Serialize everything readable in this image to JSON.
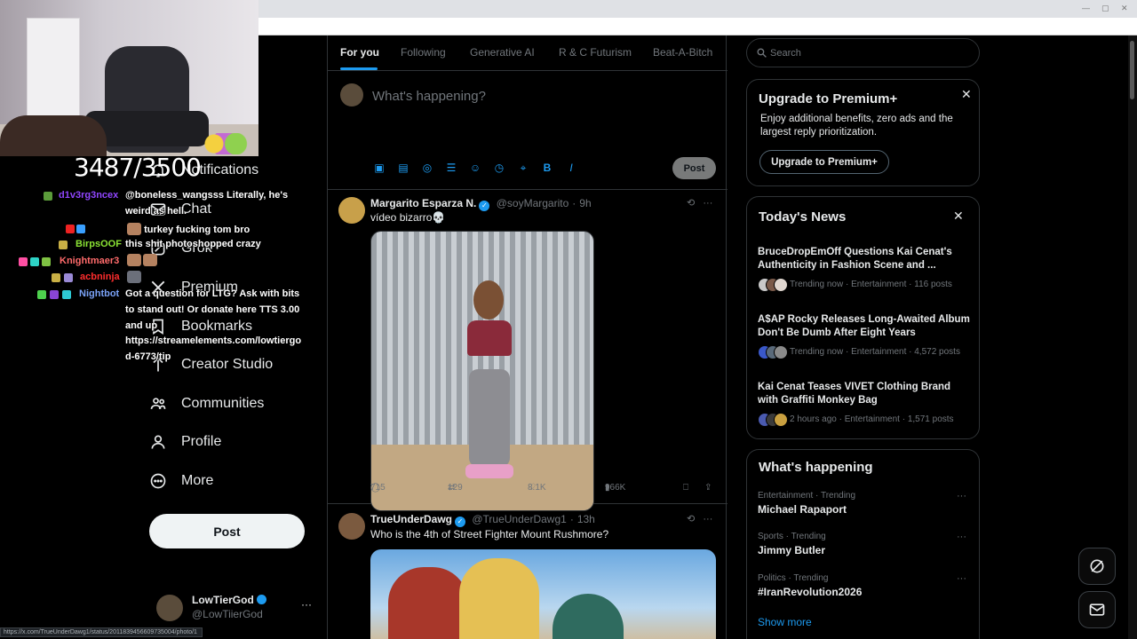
{
  "overlay": {
    "sub_count": "3487/3500"
  },
  "chat": [
    {
      "user": "d1v3rg3ncex",
      "color": "#9146ff",
      "text": "@boneless_wangsss Literally, he's",
      "text2": "weird as hell."
    },
    {
      "user": "",
      "color": "#ff4500",
      "text": "turkey fucking tom bro"
    },
    {
      "user": "BirpsOOF",
      "color": "#8ae234",
      "text": "this shit photoshopped crazy"
    },
    {
      "user": "Knightmaer3",
      "color": "#ff6b6b",
      "text": ""
    },
    {
      "user": "acbninja",
      "color": "#ff2d2d",
      "text": ""
    },
    {
      "user": "Nightbot",
      "color": "#7aa2f7",
      "text": "Got a question for LTG? Ask with bits",
      "text2": "to stand out! Or donate here TTS 3.00",
      "text3": "and up",
      "text4": "https://streamelements.com/lowtiergo",
      "text5": "d-6773/tip"
    }
  ],
  "sidebar": {
    "items": [
      {
        "label": "Notifications",
        "icon": "bell-icon"
      },
      {
        "label": "Chat",
        "icon": "mail-icon"
      },
      {
        "label": "Grok",
        "icon": "grok-icon"
      },
      {
        "label": "Premium",
        "icon": "x-logo-icon"
      },
      {
        "label": "Bookmarks",
        "icon": "bookmark-icon"
      },
      {
        "label": "Creator Studio",
        "icon": "creator-studio-icon"
      },
      {
        "label": "Communities",
        "icon": "communities-icon"
      },
      {
        "label": "Profile",
        "icon": "profile-icon"
      },
      {
        "label": "More",
        "icon": "more-circle-icon"
      }
    ],
    "post_label": "Post",
    "account": {
      "name": "LowTierGod",
      "handle": "@LowTiierGod",
      "more": "···"
    }
  },
  "timeline": {
    "tabs": [
      "For you",
      "Following",
      "Generative AI",
      "R & C Futurism",
      "Beat-A-Bitch"
    ],
    "active_tab": "For you",
    "composer": {
      "placeholder": "What's happening?",
      "post_label": "Post"
    },
    "tweets": [
      {
        "name": "Margarito Esparza N.",
        "handle": "@soyMargarito",
        "time": "9h",
        "text": "vídeo bizarro💀",
        "replies": "715",
        "reposts": "129",
        "likes": "8.1K",
        "views": "966K"
      },
      {
        "name": "TrueUnderDawg",
        "handle": "@TrueUnderDawg1",
        "time": "13h",
        "text": "Who is the 4th of Street Fighter Mount Rushmore?"
      }
    ]
  },
  "right": {
    "search_placeholder": "Search",
    "premium": {
      "title": "Upgrade to Premium+",
      "desc": "Enjoy additional benefits, zero ads and the largest reply prioritization.",
      "button": "Upgrade to Premium+"
    },
    "news": {
      "title": "Today's News",
      "items": [
        {
          "headline": "BruceDropEmOff Questions Kai Cenat's Authenticity in Fashion Scene and ...",
          "meta": "Trending now · Entertainment · 116 posts"
        },
        {
          "headline": "A$AP Rocky Releases Long-Awaited Album Don't Be Dumb After Eight Years",
          "meta": "Trending now · Entertainment · 4,572 posts"
        },
        {
          "headline": "Kai Cenat Teases VIVET Clothing Brand with Graffiti Monkey Bag",
          "meta": "2 hours ago · Entertainment · 1,571 posts"
        }
      ]
    },
    "happening": {
      "title": "What's happening",
      "trends": [
        {
          "context": "Entertainment · Trending",
          "topic": "Michael Rapaport"
        },
        {
          "context": "Sports · Trending",
          "topic": "Jimmy Butler"
        },
        {
          "context": "Politics · Trending",
          "topic": "#IranRevolution2026"
        }
      ],
      "show_more": "Show more"
    }
  },
  "status_url": "https://x.com/TrueUnderDawg1/status/2011839456609735004/photo/1"
}
